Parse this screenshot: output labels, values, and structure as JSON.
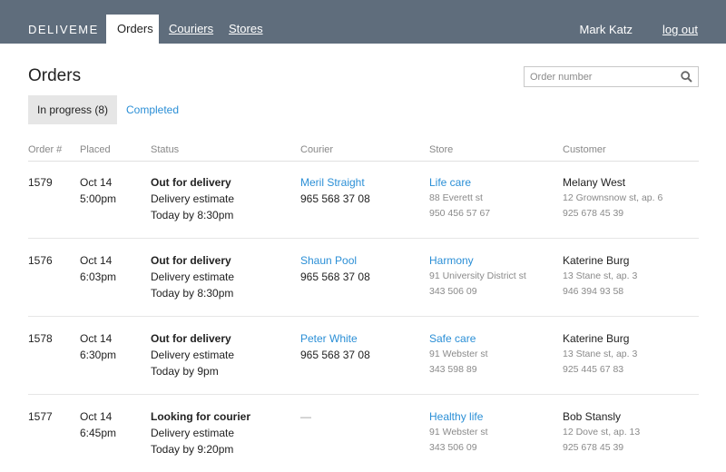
{
  "app": {
    "logo": "DELIVEME",
    "user_name": "Mark Katz",
    "logout_label": "log out"
  },
  "nav": {
    "orders": "Orders",
    "couriers": "Couriers",
    "stores": "Stores"
  },
  "page": {
    "title": "Orders"
  },
  "search": {
    "placeholder": "Order number",
    "icon": "search-icon"
  },
  "status_tabs": {
    "in_progress": "In progress (8)",
    "completed": "Completed"
  },
  "columns": {
    "order": "Order #",
    "placed": "Placed",
    "status": "Status",
    "courier": "Courier",
    "store": "Store",
    "customer": "Customer"
  },
  "orders": [
    {
      "number": "1579",
      "date": "Oct 14",
      "time": "5:00pm",
      "status": "Out for delivery",
      "estimate_label": "Delivery estimate",
      "estimate": "Today by 8:30pm",
      "courier": {
        "name": "Meril Straight",
        "phone": "965 568 37 08"
      },
      "store": {
        "name": "Life care",
        "address": "88 Everett st",
        "phone": "950 456 57 67"
      },
      "customer": {
        "name": "Melany West",
        "address": "12 Grownsnow st, ap. 6",
        "phone": "925 678 45 39"
      }
    },
    {
      "number": "1576",
      "date": "Oct 14",
      "time": "6:03pm",
      "status": "Out for delivery",
      "estimate_label": "Delivery estimate",
      "estimate": "Today by 8:30pm",
      "courier": {
        "name": "Shaun Pool",
        "phone": "965 568 37 08"
      },
      "store": {
        "name": "Harmony",
        "address": "91 University District st",
        "phone": "343 506 09"
      },
      "customer": {
        "name": "Katerine Burg",
        "address": "13 Stane st, ap. 3",
        "phone": "946 394 93 58"
      }
    },
    {
      "number": "1578",
      "date": "Oct 14",
      "time": "6:30pm",
      "status": "Out for delivery",
      "estimate_label": "Delivery estimate",
      "estimate": "Today by 9pm",
      "courier": {
        "name": "Peter White",
        "phone": "965 568 37 08"
      },
      "store": {
        "name": "Safe care",
        "address": "91 Webster st",
        "phone": "343 598 89"
      },
      "customer": {
        "name": "Katerine Burg",
        "address": "13 Stane st, ap. 3",
        "phone": "925 445 67 83"
      }
    },
    {
      "number": "1577",
      "date": "Oct 14",
      "time": "6:45pm",
      "status": "Looking for courier",
      "estimate_label": "Delivery estimate",
      "estimate": "Today by 9:20pm",
      "courier": {
        "name": "—",
        "phone": ""
      },
      "store": {
        "name": "Healthy life",
        "address": "91 Webster st",
        "phone": "343 506 09"
      },
      "customer": {
        "name": "Bob Stansly",
        "address": "12 Dove st, ap. 13",
        "phone": "925 678 45 39"
      }
    }
  ],
  "colors": {
    "topbar": "#5f6d7c",
    "link": "#2b8fd6",
    "active_tab_bg": "#e6e6e6"
  }
}
